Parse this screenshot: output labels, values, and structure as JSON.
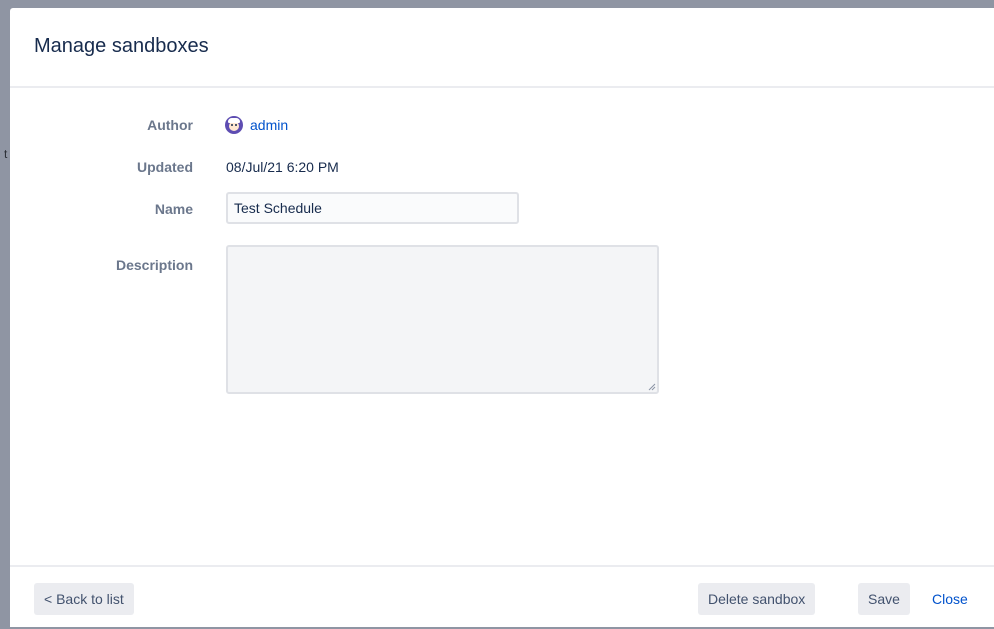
{
  "dialog": {
    "title": "Manage sandboxes"
  },
  "fields": {
    "author_label": "Author",
    "author_value": "admin",
    "updated_label": "Updated",
    "updated_value": "08/Jul/21 6:20 PM",
    "name_label": "Name",
    "name_value": "Test Schedule",
    "description_label": "Description",
    "description_value": ""
  },
  "footer": {
    "back_label": "< Back to list",
    "delete_label": "Delete sandbox",
    "save_label": "Save",
    "close_label": "Close"
  },
  "backdrop": {
    "glyph": "t"
  },
  "icons": {
    "avatar": "user-avatar-icon",
    "resize": "resize-grip-icon"
  },
  "colors": {
    "link": "#0052cc",
    "title": "#172b4d",
    "label": "#6b778c",
    "button_bg": "#ebecf0",
    "avatar_bg": "#5e4db2"
  }
}
